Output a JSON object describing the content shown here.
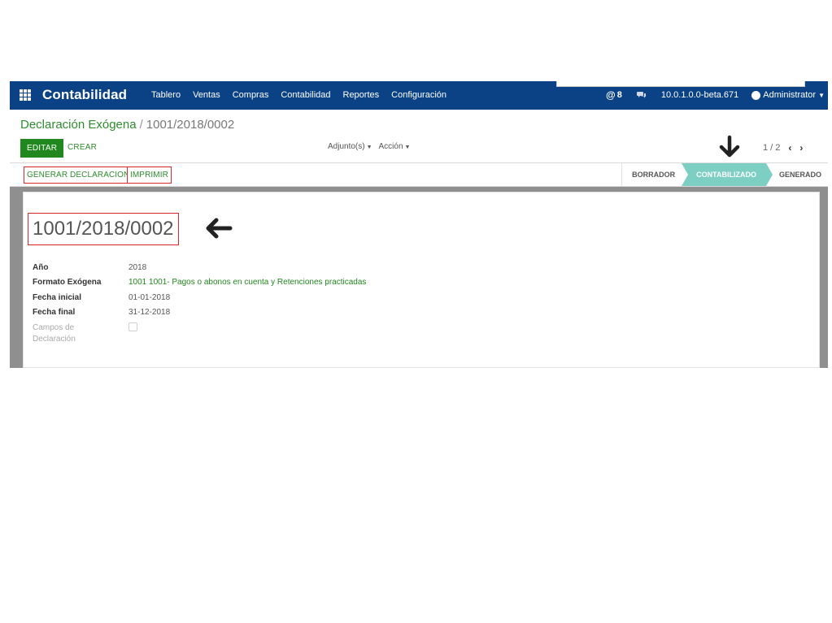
{
  "navbar": {
    "app_title": "Contabilidad",
    "menu": [
      "Tablero",
      "Ventas",
      "Compras",
      "Contabilidad",
      "Reportes",
      "Configuración"
    ],
    "mentions_count": "8",
    "version": "10.0.1.0.0-beta.671",
    "user": "Administrator",
    "color": "#0b4285"
  },
  "breadcrumb": {
    "parent": "Declaración Exógena",
    "separator": "/",
    "current": "1001/2018/0002"
  },
  "buttons": {
    "edit": "EDITAR",
    "create": "CREAR",
    "generate": "GENERAR DECLARACION",
    "print": "IMPRIMIR"
  },
  "dropdowns": {
    "attachments": "Adjunto(s)",
    "action": "Acción"
  },
  "pager": {
    "value": "1 / 2"
  },
  "stages": [
    "BORRADOR",
    "CONTABILIZADO",
    "GENERADO"
  ],
  "active_stage": "CONTABILIZADO",
  "record": {
    "name": "1001/2018/0002",
    "fields": [
      {
        "label": "Año",
        "value": "2018"
      },
      {
        "label": "Formato Exógena",
        "value": "1001 1001- Pagos o abonos en cuenta y Retenciones practicadas"
      },
      {
        "label": "Fecha inicial",
        "value": "01-01-2018"
      },
      {
        "label": "Fecha final",
        "value": "31-12-2018"
      },
      {
        "label": "Campos de Declaración",
        "value": ""
      }
    ]
  },
  "colors": {
    "primary_green": "#21871f",
    "stage_active": "#7dcfc3",
    "highlight_red": "#d9262b"
  }
}
